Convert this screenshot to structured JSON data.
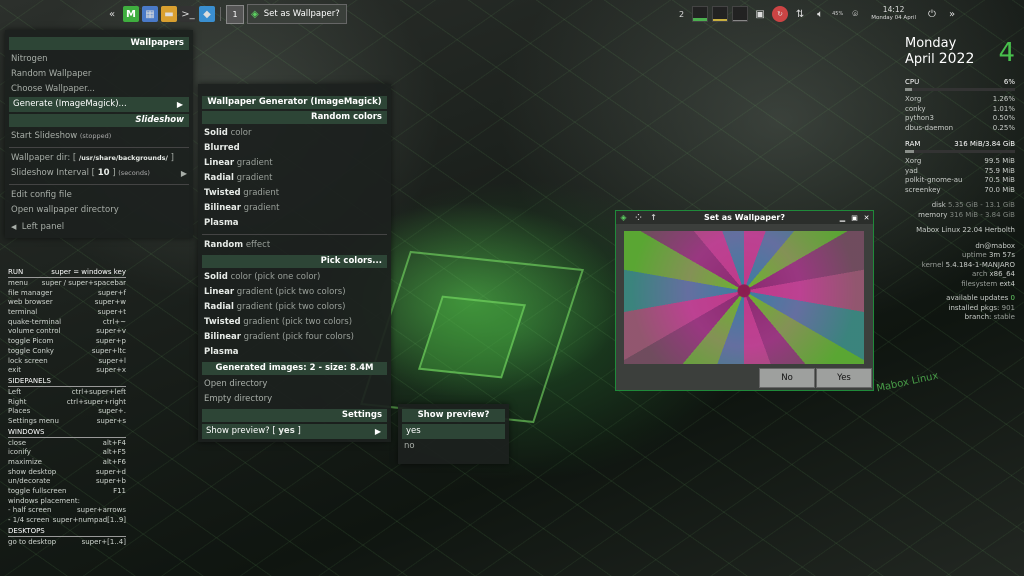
{
  "topbar": {
    "workspace": "1",
    "task_title": "Set as Wallpaper?",
    "tray_num": "2",
    "time": "14:12",
    "date": "Monday 04 April",
    "volume": "45%"
  },
  "nitrogen_menu": {
    "header": "Wallpapers",
    "items": [
      "Nitrogen",
      "Random Wallpaper",
      "Choose Wallpaper..."
    ],
    "generate": "Generate (ImageMagick)...",
    "slideshow_header": "Slideshow",
    "start_slideshow": "Start Slideshow",
    "start_slideshow_note": "(stopped)",
    "wallpaper_dir_label": "Wallpaper dir: [",
    "wallpaper_dir_value": "/usr/share/backgrounds/",
    "wallpaper_dir_close": "]",
    "interval_label": "Slideshow Interval [",
    "interval_value": "10",
    "interval_close": "]",
    "interval_unit": "(seconds)",
    "edit_config": "Edit config file",
    "open_dir": "Open wallpaper directory",
    "left_panel": "Left panel"
  },
  "generator_menu": {
    "header": "Wallpaper Generator (ImageMagick)",
    "random_header": "Random colors",
    "random_items": [
      {
        "b": "Solid",
        "r": " color"
      },
      {
        "b": "Blurred",
        "r": ""
      },
      {
        "b": "Linear",
        "r": " gradient"
      },
      {
        "b": "Radial",
        "r": " gradient"
      },
      {
        "b": "Twisted",
        "r": " gradient"
      },
      {
        "b": "Bilinear",
        "r": " gradient"
      },
      {
        "b": "Plasma",
        "r": ""
      }
    ],
    "random_effect_b": "Random",
    "random_effect_r": " effect",
    "pick_header": "Pick colors...",
    "pick_items": [
      {
        "b": "Solid",
        "r": " color (pick one color)"
      },
      {
        "b": "Linear",
        "r": " gradient (pick two colors)"
      },
      {
        "b": "Radial",
        "r": " gradient (pick two colors)"
      },
      {
        "b": "Twisted",
        "r": " gradient (pick two colors)"
      },
      {
        "b": "Bilinear",
        "r": " gradient (pick four colors)"
      },
      {
        "b": "Plasma",
        "r": ""
      }
    ],
    "generated_header": "Generated images: 2 - size: 8.4M",
    "open_directory": "Open directory",
    "empty_directory": "Empty directory",
    "settings_header": "Settings",
    "show_preview_label": "Show preview? [",
    "show_preview_value": "yes",
    "show_preview_close": "]"
  },
  "preview_menu": {
    "header": "Show preview?",
    "options": [
      "yes",
      "no"
    ]
  },
  "dialog": {
    "title": "Set as Wallpaper?",
    "no": "No",
    "yes": "Yes"
  },
  "keybinds": {
    "run": {
      "title": "RUN",
      "note": "super = windows key",
      "rows": [
        [
          "menu",
          "super / super+spacebar"
        ],
        [
          "file manager",
          "super+f"
        ],
        [
          "web browser",
          "super+w"
        ],
        [
          "terminal",
          "super+t"
        ],
        [
          "quake-terminal",
          "ctrl+~"
        ],
        [
          "volume control",
          "super+v"
        ],
        [
          "toggle Picom",
          "super+p"
        ],
        [
          "toggle Conky",
          "super+ltc"
        ],
        [
          "lock screen",
          "super+l"
        ],
        [
          "exit",
          "super+x"
        ]
      ]
    },
    "sidepanels": {
      "title": "SIDEPANELS",
      "rows": [
        [
          "Left",
          "ctrl+super+left"
        ],
        [
          "Right",
          "ctrl+super+right"
        ],
        [
          "Places",
          "super+."
        ],
        [
          "Settings menu",
          "super+s"
        ]
      ]
    },
    "windows": {
      "title": "WINDOWS",
      "rows": [
        [
          "close",
          "alt+F4"
        ],
        [
          "iconify",
          "alt+F5"
        ],
        [
          "maximize",
          "alt+F6"
        ],
        [
          "show desktop",
          "super+d"
        ],
        [
          "un/decorate",
          "super+b"
        ],
        [
          "toggle fullscreen",
          "F11"
        ],
        [
          "windows placement:",
          ""
        ],
        [
          " - half screen",
          "super+arrows"
        ],
        [
          " - 1/4 screen",
          "super+numpad[1..9]"
        ]
      ]
    },
    "desktops": {
      "title": "DESKTOPS",
      "rows": [
        [
          "go to desktop",
          "super+[1..4]"
        ]
      ]
    }
  },
  "conky": {
    "day": "Monday",
    "month": "April",
    "year": "2022",
    "daynum": "4",
    "cpu_label": "CPU",
    "cpu_value": "6%",
    "cpu_fraction": 0.06,
    "cpu_procs": [
      [
        "Xorg",
        "1.26%"
      ],
      [
        "conky",
        "1.01%"
      ],
      [
        "python3",
        "0.50%"
      ],
      [
        "dbus-daemon",
        "0.25%"
      ]
    ],
    "ram_label": "RAM",
    "ram_value": "316 MiB/3.84 GiB",
    "ram_fraction": 0.08,
    "ram_procs": [
      [
        "Xorg",
        "99.5 MiB"
      ],
      [
        "yad",
        "75.9 MiB"
      ],
      [
        "polkit-gnome-au",
        "70.5 MiB"
      ],
      [
        "screenkey",
        "70.0 MiB"
      ]
    ],
    "disk_label": "disk",
    "disk_value": "5.35 GiB - 13.1 GiB",
    "memory_label": "memory",
    "memory_value": "316 MiB - 3.84 GiB",
    "distro": "Mabox Linux 22.04 Herbolth",
    "user": "dn@mabox",
    "uptime_label": "uptime",
    "uptime_value": "3m 57s",
    "kernel_label": "kernel",
    "kernel_value": "5.4.184-1-MANJARO",
    "arch_label": "arch",
    "arch_value": "x86_64",
    "fs_label": "filesystem",
    "fs_value": "ext4",
    "updates_label": "available updates",
    "updates_value": "0",
    "pkgs_label": "installed pkgs:",
    "pkgs_value": "901",
    "branch_label": "branch:",
    "branch_value": "stable"
  },
  "watermark": "Mabox Linux"
}
